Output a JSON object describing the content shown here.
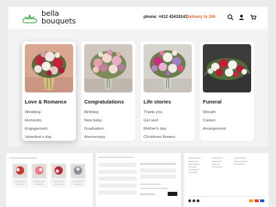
{
  "brand": {
    "line1": "bella",
    "line2": "bouquets"
  },
  "header": {
    "phone": "phone: +612 43419143",
    "delivery": "Delivery to 24h",
    "icons": [
      "search-icon",
      "user-icon",
      "cart-icon"
    ]
  },
  "categories": [
    {
      "title": "Love & Romance",
      "items": [
        "Wedding",
        "Romantic",
        "Engagement",
        "Valentine's day"
      ]
    },
    {
      "title": "Congratulations",
      "items": [
        "Birthday",
        "New baby",
        "Graduation",
        "Anniversary"
      ]
    },
    {
      "title": "Life stories",
      "items": [
        "Thank you",
        "Get well",
        "Mother's day",
        "Christmas flowers"
      ]
    },
    {
      "title": "Funeral",
      "items": [
        "Wreath",
        "Casket",
        "Arrangement"
      ]
    }
  ],
  "colors": {
    "accent": "#e8632a",
    "logo_green": "#3aa845",
    "background": "#ececec"
  }
}
